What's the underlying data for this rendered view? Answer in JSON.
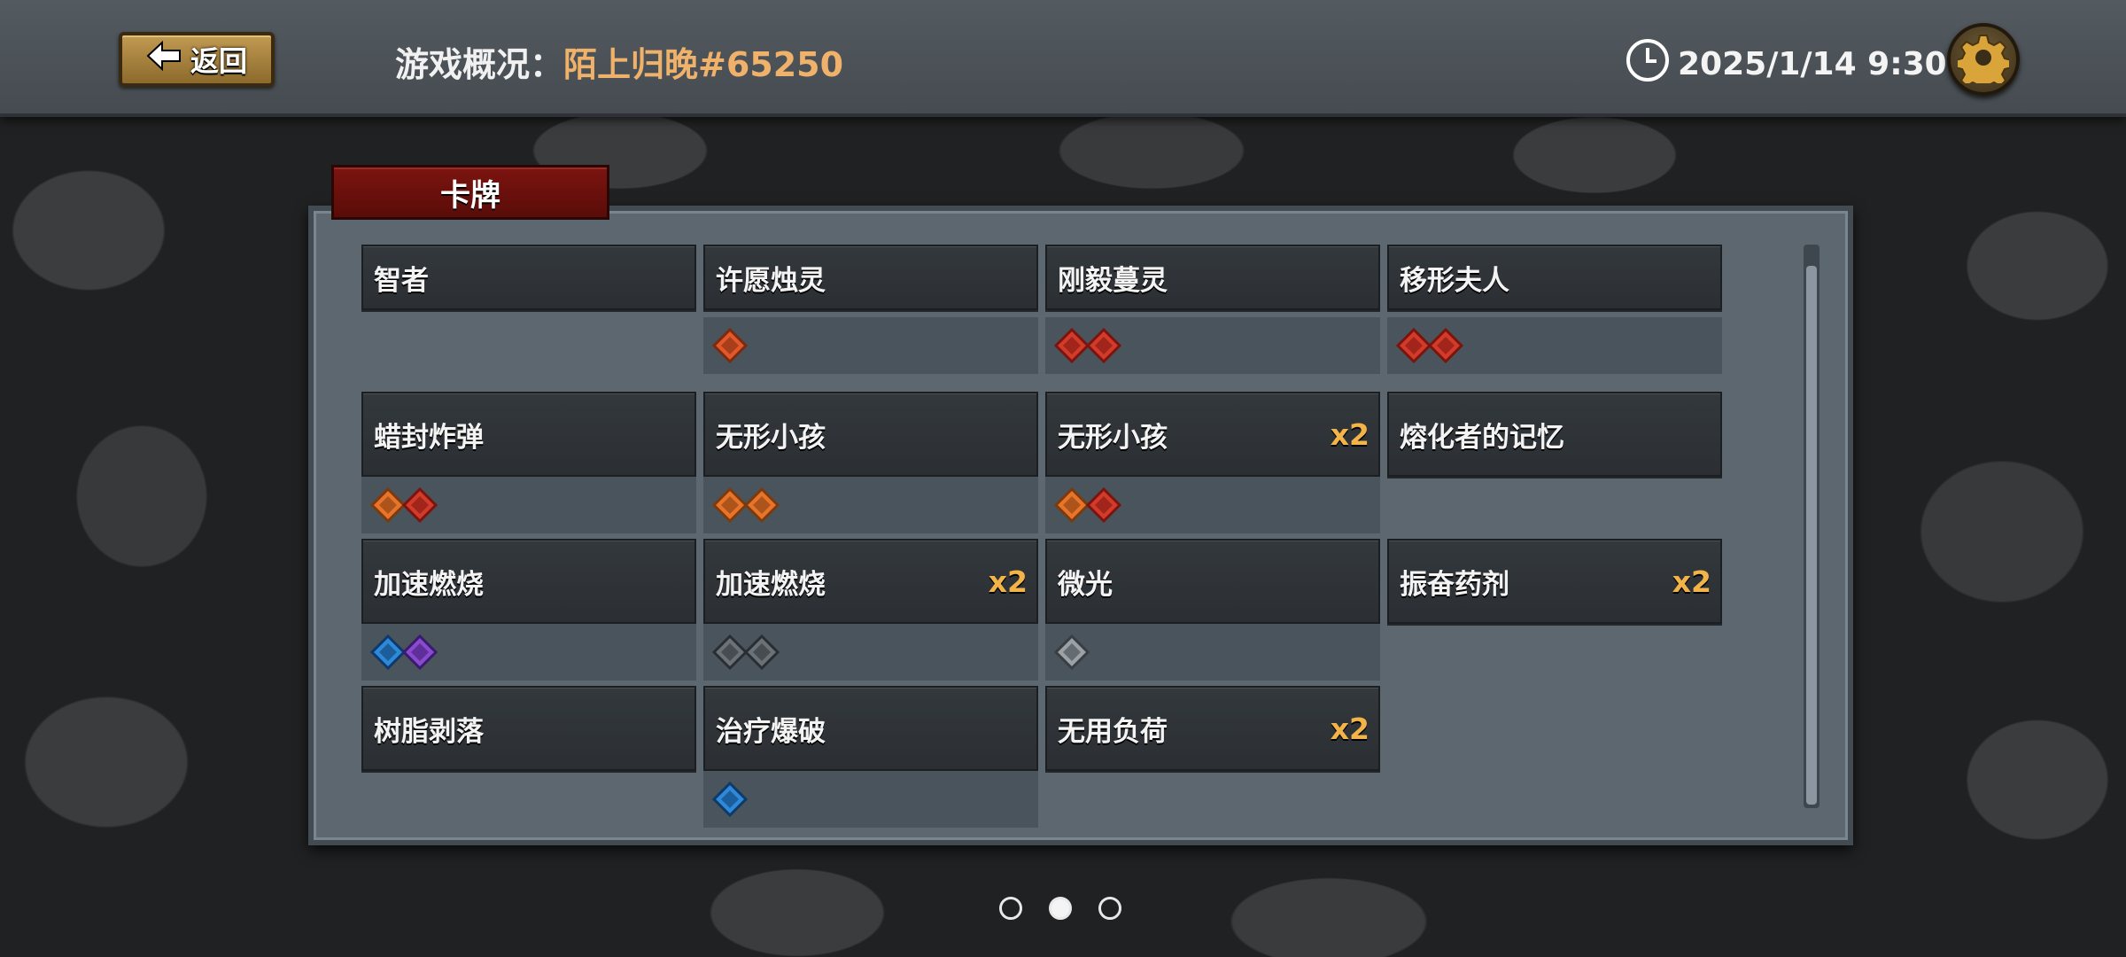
{
  "header": {
    "back_label": "返回",
    "title_prefix": "游戏概况：",
    "player_name": "陌上归晚#65250",
    "datetime": "2025/1/14 9:30"
  },
  "panel": {
    "tab_label": "卡牌",
    "cards": [
      {
        "name": "智者",
        "count": "",
        "tags": []
      },
      {
        "name": "许愿烛灵",
        "count": "",
        "tags": [
          "red-orange"
        ]
      },
      {
        "name": "刚毅蔓灵",
        "count": "",
        "tags": [
          "red",
          "red"
        ]
      },
      {
        "name": "移形夫人",
        "count": "",
        "tags": [
          "red",
          "red"
        ]
      },
      {
        "name": "蜡封炸弹",
        "count": "",
        "tags": [
          "orange",
          "red"
        ]
      },
      {
        "name": "无形小孩",
        "count": "",
        "tags": [
          "orange",
          "orange"
        ]
      },
      {
        "name": "无形小孩",
        "count": "x2",
        "tags": [
          "orange",
          "red"
        ]
      },
      {
        "name": "熔化者的记忆",
        "count": "",
        "tags": []
      },
      {
        "name": "加速燃烧",
        "count": "",
        "tags": [
          "blue",
          "purple"
        ]
      },
      {
        "name": "加速燃烧",
        "count": "x2",
        "tags": [
          "gray",
          "gray"
        ]
      },
      {
        "name": "微光",
        "count": "",
        "tags": [
          "silver"
        ]
      },
      {
        "name": "振奋药剂",
        "count": "x2",
        "tags": []
      },
      {
        "name": "树脂剥落",
        "count": "",
        "tags": []
      },
      {
        "name": "治疗爆破",
        "count": "",
        "tags": [
          "blue"
        ]
      },
      {
        "name": "无用负荷",
        "count": "x2",
        "tags": []
      }
    ]
  },
  "pager": {
    "pages": 3,
    "current": 2
  },
  "colors": {
    "accent_gold": "#f0b26a",
    "count_gold": "#f2b448",
    "tab_red": "#7c1410"
  },
  "icons": {
    "back": "arrow-left-icon",
    "clock": "clock-icon",
    "settings": "gear-icon"
  }
}
